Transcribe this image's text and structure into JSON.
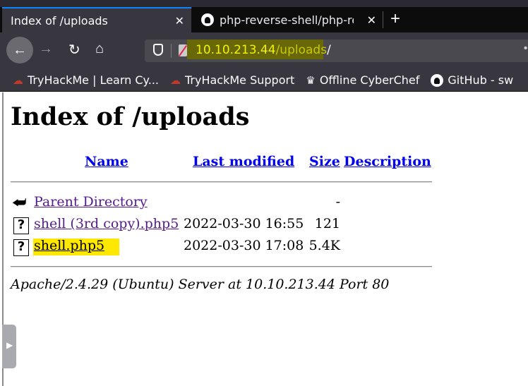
{
  "browser": {
    "tabs": [
      {
        "title": "Index of /uploads",
        "active": true
      },
      {
        "title": "php-reverse-shell/php-re",
        "active": false
      }
    ],
    "url": {
      "host": "10.10.213.44",
      "path": "/uploads",
      "trailing": "/"
    },
    "bookmarks": [
      {
        "label": "TryHackMe | Learn Cy...",
        "icon": "tryhackme-cloud-icon"
      },
      {
        "label": "TryHackMe Support",
        "icon": "tryhackme-cloud-icon"
      },
      {
        "label": "Offline CyberChef",
        "icon": "chef-hat-icon"
      },
      {
        "label": "GitHub - sw",
        "icon": "github-icon"
      }
    ],
    "highlight_color": "#ffe800"
  },
  "page": {
    "title": "Index of /uploads",
    "columns": {
      "name": "Name",
      "modified": "Last modified",
      "size": "Size",
      "description": "Description"
    },
    "rows": [
      {
        "name": "Parent Directory",
        "modified": "",
        "size": "-",
        "icon": "back-arrow-icon"
      },
      {
        "name": "shell (3rd copy).php5",
        "modified": "2022-03-30 16:55",
        "size": "121",
        "icon": "unknown-file-icon"
      },
      {
        "name": "shell.php5",
        "modified": "2022-03-30 17:08",
        "size": "5.4K",
        "icon": "unknown-file-icon",
        "highlighted": true
      }
    ],
    "address": "Apache/2.4.29 (Ubuntu) Server at 10.10.213.44 Port 80"
  }
}
